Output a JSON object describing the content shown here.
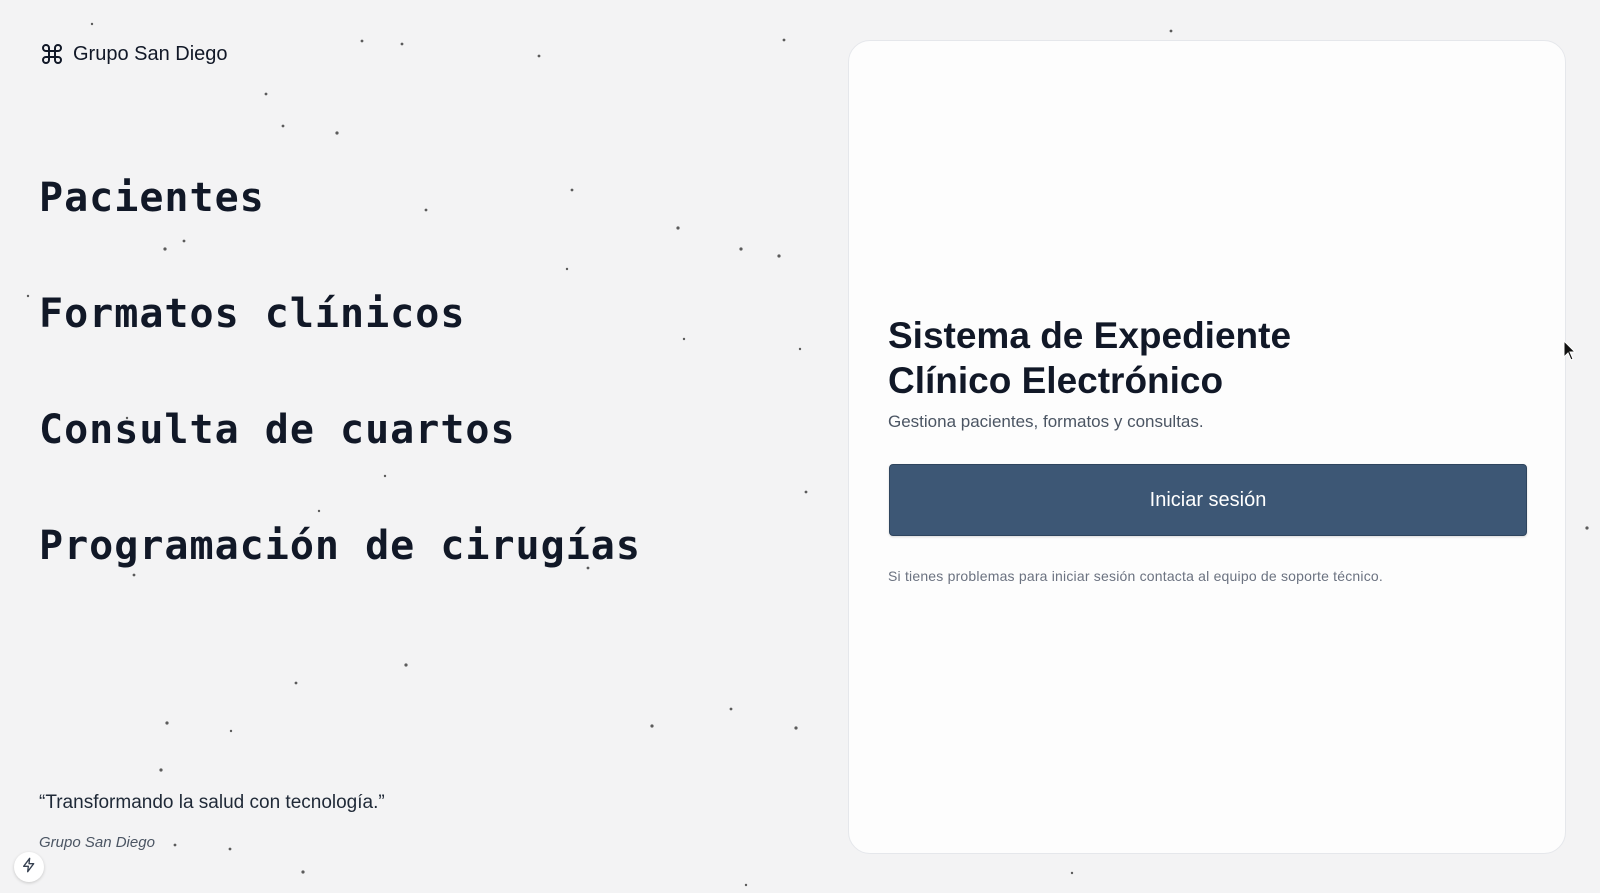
{
  "brand": {
    "icon": "command-icon",
    "name": "Grupo San Diego"
  },
  "features": [
    {
      "label": "Pacientes"
    },
    {
      "label": "Formatos clínicos"
    },
    {
      "label": "Consulta de cuartos"
    },
    {
      "label": "Programación de cirugías"
    }
  ],
  "quote": {
    "text": "“Transformando la salud con tecnología.”",
    "author": "Grupo San Diego"
  },
  "login_card": {
    "title_line1": "Sistema de Expediente",
    "title_line2": "Clínico Electrónico",
    "subtitle": "Gestiona pacientes, formatos y consultas.",
    "button_label": "Iniciar sesión",
    "help_text": "Si tienes problemas para iniciar sesión contacta al equipo de soporte técnico."
  },
  "badge": {
    "icon": "lightning-icon"
  },
  "colors": {
    "background": "#f3f3f4",
    "card": "#fdfdfd",
    "button": "#3d5775",
    "text": "#111827"
  }
}
